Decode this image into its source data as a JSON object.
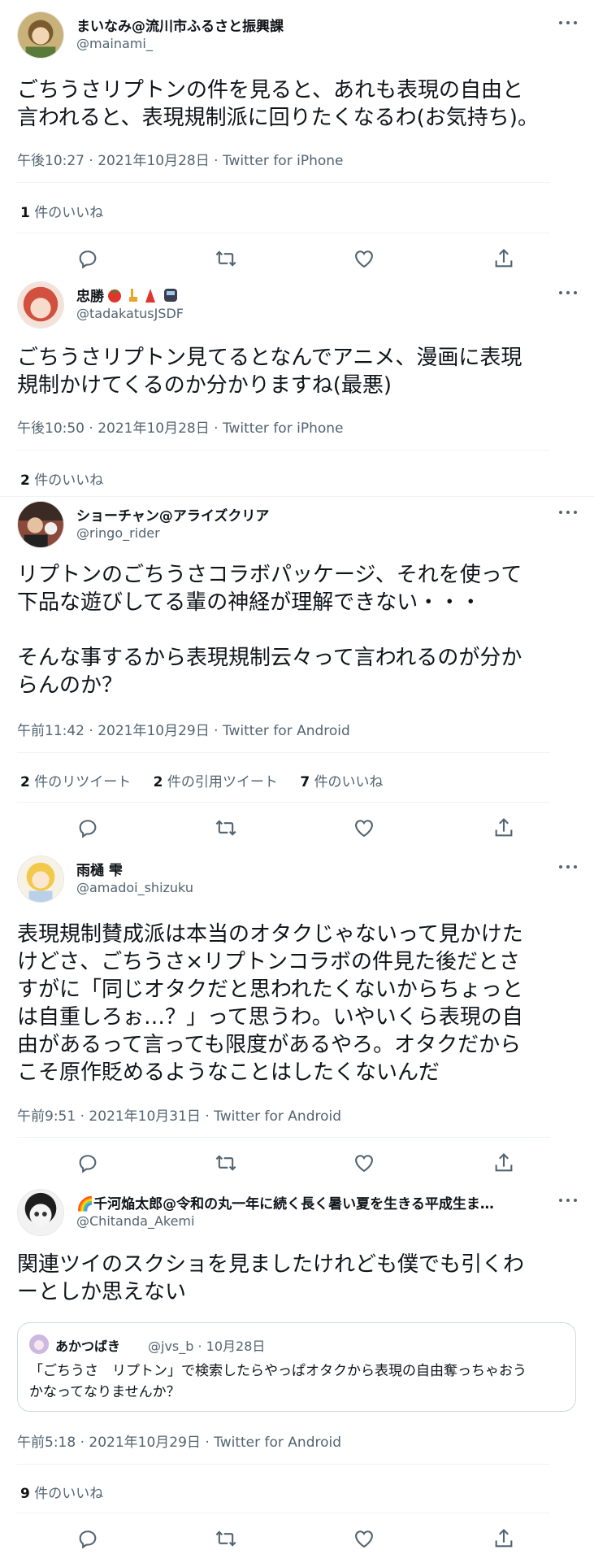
{
  "tweets": [
    {
      "name": "まいなみ@流川市ふるさと振興課",
      "handle": "@mainami_",
      "text": "ごちうさリプトンの件を見ると、あれも表現の自由と\n言われると、表現規制派に回りたくなるわ(お気持ち)。",
      "meta": "午後10:27 · 2021年10月28日 · Twitter for iPhone",
      "stats": [
        {
          "count": "1",
          "label": "件のいいね"
        }
      ]
    },
    {
      "name": "忠勝",
      "name_icons": [
        "tomato-icon",
        "giraffe-icon",
        "tokyo-tower-icon",
        "train-icon"
      ],
      "handle": "@tadakatusJSDF",
      "text": "ごちうさリプトン見てるとなんでアニメ、漫画に表現\n規制かけてくるのか分かりますね(最悪)",
      "meta": "午後10:50 · 2021年10月28日 · Twitter for iPhone",
      "stats": [
        {
          "count": "2",
          "label": "件のいいね"
        }
      ]
    },
    {
      "name": "ショーチャン@アライズクリア",
      "handle": "@ringo_rider",
      "text": "リプトンのごちうさコラボパッケージ、それを使って\n下品な遊びしてる輩の神経が理解できない・・・\n\nそんな事するから表現規制云々って言われるのが分か\nらんのか？",
      "meta": "午前11:42 · 2021年10月29日 · Twitter for Android",
      "stats": [
        {
          "count": "2",
          "label": "件のリツイート"
        },
        {
          "count": "2",
          "label": "件の引用ツイート"
        },
        {
          "count": "7",
          "label": "件のいいね"
        }
      ]
    },
    {
      "name": "雨樋 雫",
      "handle": "@amadoi_shizuku",
      "text": "表現規制賛成派は本当のオタクじゃないって見かけた\nけどさ、ごちうさ×リプトンコラボの件見た後だとさ\nすがに「同じオタクだと思われたくないからちょっと\nは自重しろぉ…？」って思うわ。いやいくら表現の自\n由があるって言っても限度があるやろ。オタクだから\nこそ原作貶めるようなことはしたくないんだ",
      "meta": "午前9:51 · 2021年10月31日 · Twitter for Android"
    },
    {
      "name": "🌈千河焔太郎@令和の丸一年に続く長く暑い夏を生きる平成生ま…",
      "handle": "@Chitanda_Akemi",
      "text": "関連ツイのスクショを見ましたけれども僕でも引くわ\nーとしか思えない",
      "quote": {
        "name": "あかつばき",
        "handle": "@jvs_b · 10月28日",
        "text": "「ごちうさ　リプトン」で検索したらやっぱオタクから表現の自由奪っちゃおう\nかなってなりませんか？"
      },
      "meta": "午前5:18 · 2021年10月29日 · Twitter for Android",
      "stats": [
        {
          "count": "9",
          "label": "件のいいね"
        }
      ]
    }
  ],
  "actions": [
    "reply-icon",
    "retweet-icon",
    "like-icon",
    "share-icon"
  ],
  "colors": {
    "text": "#0f1419",
    "muted": "#536471",
    "divider": "#eff3f4",
    "border": "#cfd9de"
  }
}
